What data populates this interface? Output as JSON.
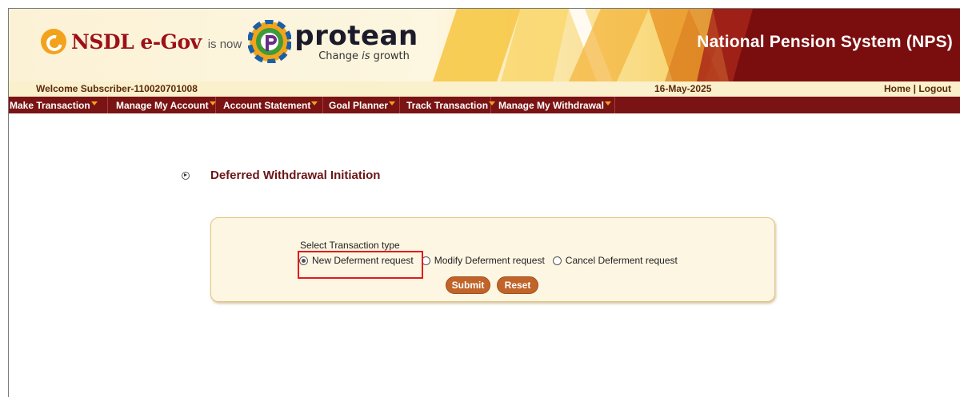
{
  "banner": {
    "nsdl_text": "NSDL e-Gov",
    "is_now": "is now",
    "protean_word": "protean",
    "protean_tag_start": "Change ",
    "protean_tag_is": "is",
    "protean_tag_end": " growth",
    "system_title": "National Pension System (NPS)"
  },
  "welcome_bar": {
    "welcome": "Welcome Subscriber-110020701008",
    "date": "16-May-2025",
    "home": "Home",
    "separator": " | ",
    "logout": "Logout"
  },
  "menu": {
    "items": [
      {
        "label": "Make Transaction"
      },
      {
        "label": "Manage My Account"
      },
      {
        "label": "Account Statement"
      },
      {
        "label": "Goal Planner"
      },
      {
        "label": "Track Transaction"
      },
      {
        "label": "Manage My Withdrawal"
      }
    ]
  },
  "main": {
    "section_title": "Deferred Withdrawal Initiation",
    "form": {
      "label": "Select Transaction type",
      "options": [
        {
          "label": "New Deferment request",
          "checked": true
        },
        {
          "label": "Modify Deferment request",
          "checked": false
        },
        {
          "label": "Cancel Deferment request",
          "checked": false
        }
      ],
      "submit_label": "Submit",
      "reset_label": "Reset"
    }
  },
  "colors": {
    "menu_bg": "#7a1414",
    "banner_dark": "#7a0e0e",
    "accent_orange": "#c0642a",
    "highlight": "#e21b1b",
    "panel_bg": "#fdf6e3"
  }
}
